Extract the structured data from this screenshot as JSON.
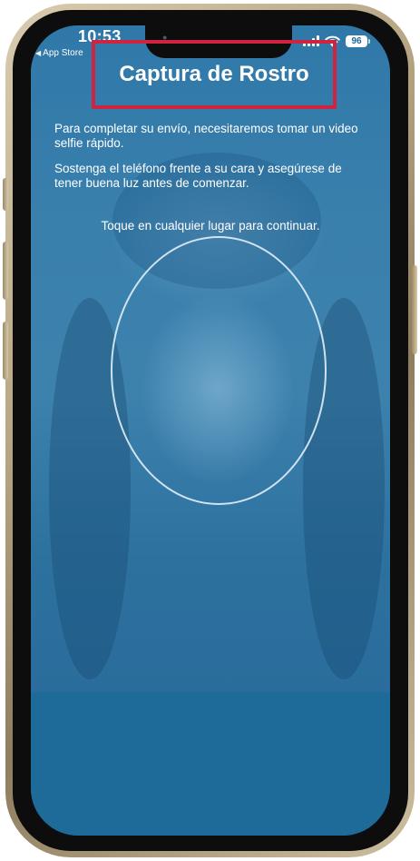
{
  "status_bar": {
    "time": "10:53",
    "back_app": "App Store",
    "battery": "96",
    "icons": [
      "signal-icon",
      "wifi-icon",
      "battery-icon",
      "back-arrow-icon"
    ]
  },
  "header": {
    "title": "Captura de Rostro"
  },
  "instructions": {
    "paragraph_1": "Para completar su envío, necesitaremos tomar un video selfie rápido.",
    "paragraph_2": "Sostenga el teléfono frente a su cara y asegúrese de tener buena luz antes de comenzar.",
    "tap_hint": "Toque en cualquier lugar para continuar."
  },
  "colors": {
    "overlay_blue": "#1d6a98",
    "highlight_red": "#d0233f",
    "text": "#ffffff"
  }
}
